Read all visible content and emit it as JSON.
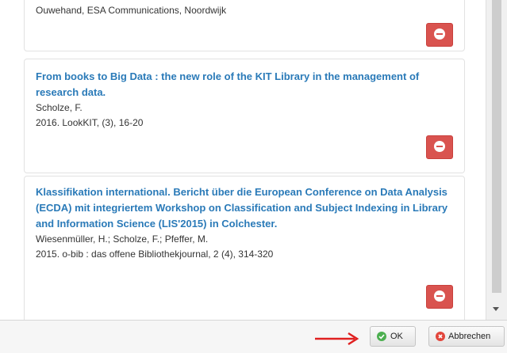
{
  "items": [
    {
      "title": "",
      "authors": "Ouwehand, ESA Communications, Noordwijk",
      "source": ""
    },
    {
      "title": "From books to Big Data : the new role of the KIT Library in the management of research data.",
      "authors": "Scholze, F.",
      "source": "2016. LookKIT, (3), 16-20"
    },
    {
      "title": "Klassifikation international. Bericht über die European Conference on Data Analysis (ECDA) mit integriertem Workshop on Classification and Subject Indexing in Library and Information Science (LIS'2015) in Colchester.",
      "authors": "Wiesenmüller, H.; Scholze, F.; Pfeffer, M.",
      "source": "2015. o-bib : das offene Bibliothekjournal, 2 (4), 314-320"
    }
  ],
  "footer": {
    "ok_label": "OK",
    "cancel_label": "Abbrechen"
  },
  "icons": {
    "delete": "remove-circle-icon",
    "ok": "check-circle-icon",
    "cancel": "close-circle-icon",
    "annotation": "red-arrow-icon"
  },
  "colors": {
    "title_link": "#2a7ab8",
    "delete_button": "#d9534f",
    "ok_icon": "#4caf50",
    "cancel_icon": "#e2463c",
    "annotation_arrow": "#e02020"
  }
}
